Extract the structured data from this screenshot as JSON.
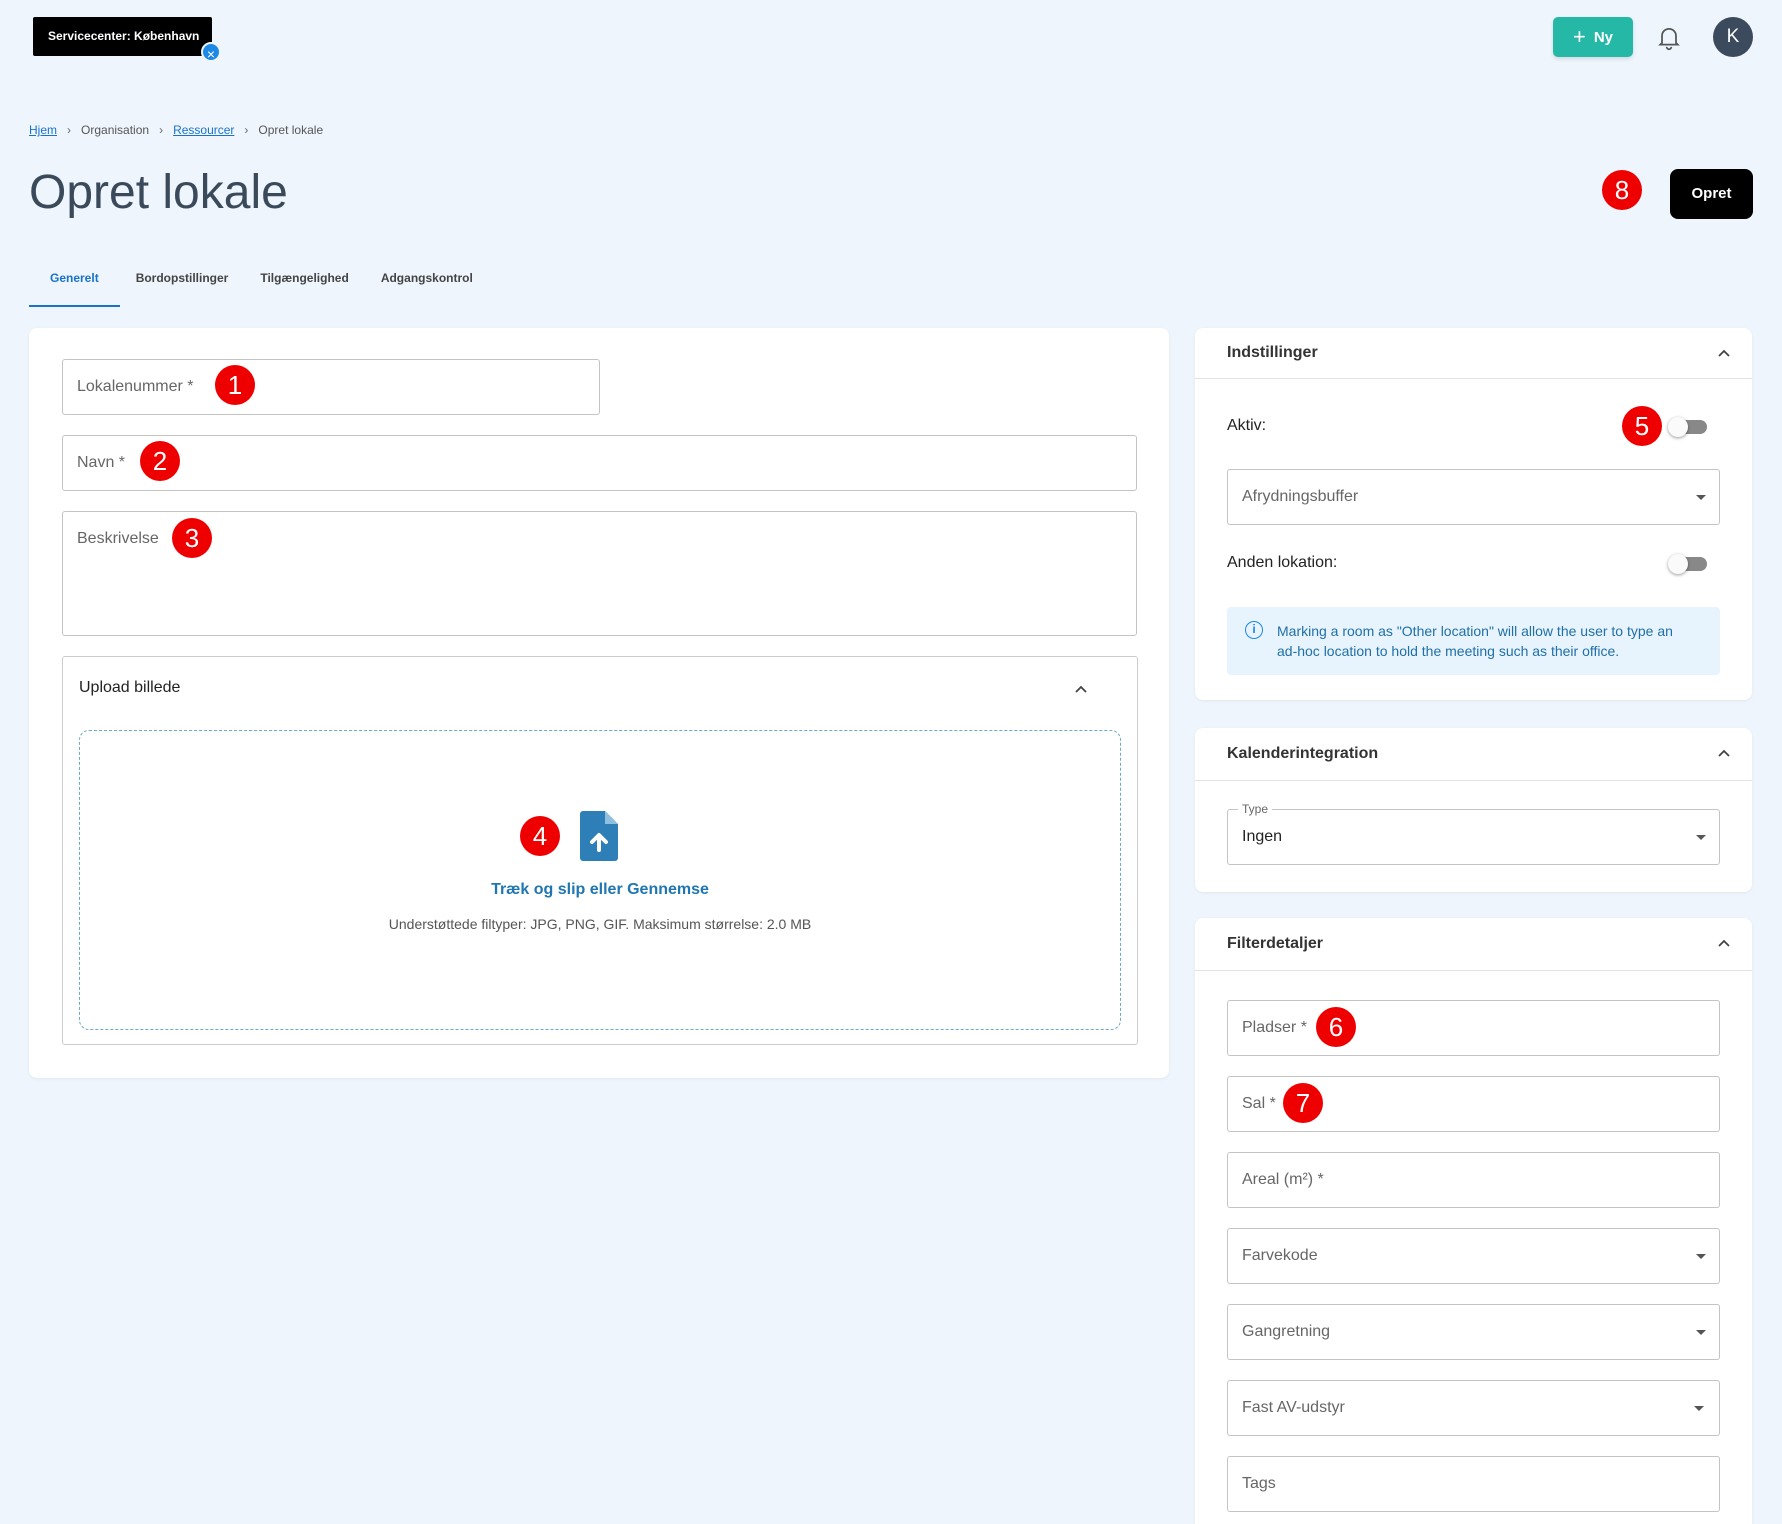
{
  "topbar": {
    "service_center": "Servicecenter: København",
    "new_button": "Ny",
    "avatar_initial": "K"
  },
  "breadcrumb": {
    "home": "Hjem",
    "organisation": "Organisation",
    "resources": "Ressourcer",
    "current": "Opret lokale"
  },
  "page": {
    "title": "Opret lokale",
    "create_button": "Opret"
  },
  "tabs": [
    "Generelt",
    "Bordopstillinger",
    "Tilgængelighed",
    "Adgangskontrol"
  ],
  "form": {
    "room_number_placeholder": "Lokalenummer *",
    "name_placeholder": "Navn *",
    "description_placeholder": "Beskrivelse"
  },
  "upload": {
    "title": "Upload billede",
    "drop_text": "Træk og slip eller Gennemse",
    "supported": "Understøttede filtyper: JPG, PNG, GIF. Maksimum størrelse: 2.0 MB"
  },
  "settings": {
    "title": "Indstillinger",
    "active_label": "Aktiv:",
    "cleanup_buffer": "Afrydningsbuffer",
    "other_location_label": "Anden lokation:",
    "info": "Marking a room as \"Other location\" will allow the user to type an ad-hoc location to hold the meeting such as their office."
  },
  "calendar": {
    "title": "Kalenderintegration",
    "type_label": "Type",
    "type_value": "Ingen"
  },
  "filter": {
    "title": "Filterdetaljer",
    "seats": "Pladser *",
    "hall": "Sal *",
    "area": "Areal (m²) *",
    "color_code": "Farvekode",
    "direction": "Gangretning",
    "av_equipment": "Fast AV-udstyr",
    "tags": "Tags"
  },
  "annotations": [
    "1",
    "2",
    "3",
    "4",
    "5",
    "6",
    "7",
    "8"
  ],
  "colors": {
    "accent": "#1a73c9",
    "new_button": "#26b8a6",
    "badge": "#ee0000"
  }
}
